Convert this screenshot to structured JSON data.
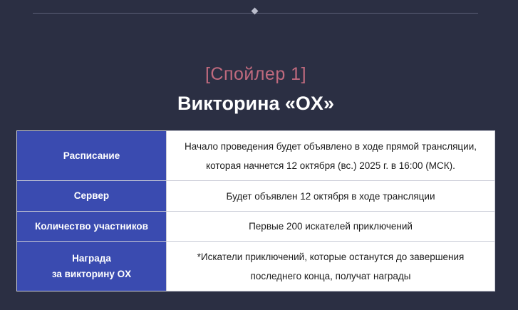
{
  "header": {
    "spoiler": "[Спойлер 1]",
    "title": "Викторина «OX»"
  },
  "table": {
    "rows": [
      {
        "key": [
          "Расписание"
        ],
        "value": [
          "Начало проведения будет объявлено в ходе прямой трансляции,",
          "которая начнется 12 октября (вс.) 2025 г. в 16:00 (МСК)."
        ]
      },
      {
        "key": [
          "Сервер"
        ],
        "value": [
          "Будет объявлен 12 октября в ходе трансляции"
        ]
      },
      {
        "key": [
          "Количество участников"
        ],
        "value": [
          "Первые 200 искателей приключений"
        ]
      },
      {
        "key": [
          "Награда",
          "за викторину OX"
        ],
        "value": [
          "*Искатели приключений, которые останутся до завершения",
          "последнего конца, получат награды"
        ]
      }
    ]
  }
}
